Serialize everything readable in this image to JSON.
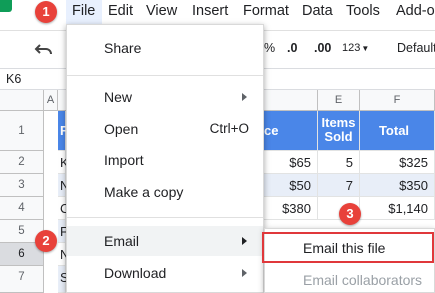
{
  "menubar": {
    "items": [
      "File",
      "Edit",
      "View",
      "Insert",
      "Format",
      "Data",
      "Tools",
      "Add-on"
    ]
  },
  "toolbar": {
    "percent": "%",
    "dec_decrease": ".0",
    "dec_increase": ".00",
    "number_format": "123",
    "font": "Default"
  },
  "namebox": {
    "value": "K6"
  },
  "grid": {
    "col_headers": [
      "A",
      "E",
      "F"
    ],
    "row_headers": [
      "1",
      "2",
      "3",
      "4",
      "5",
      "6",
      "7"
    ],
    "active_row": "6",
    "header_row": {
      "price": "ce",
      "items": "Items Sold",
      "total": "Total"
    },
    "left_peek": [
      "F",
      "K",
      "N",
      "C",
      "F",
      "N",
      "S"
    ],
    "rows": [
      {
        "price": "$65",
        "items": "5",
        "total": "$325"
      },
      {
        "price": "$50",
        "items": "7",
        "total": "$350"
      },
      {
        "price": "$380",
        "items": "",
        "total": "$1,140"
      }
    ]
  },
  "file_menu": {
    "share": "Share",
    "new": "New",
    "open": "Open",
    "open_shortcut": "Ctrl+O",
    "import": "Import",
    "make_copy": "Make a copy",
    "email": "Email",
    "download": "Download"
  },
  "email_submenu": {
    "email_file": "Email this file",
    "email_collaborators": "Email collaborators"
  },
  "badges": [
    "1",
    "2",
    "3"
  ],
  "colors": {
    "header_fill": "#4a86e8",
    "badge": "#e8413a",
    "highlight_border": "#e0383b"
  }
}
